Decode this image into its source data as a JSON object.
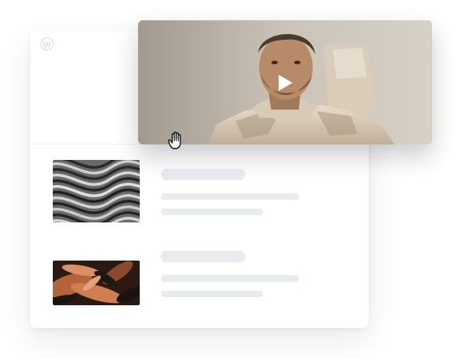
{
  "icons": {
    "logo": "wordpress-logo-icon",
    "play": "play-icon",
    "cursor": "grab-hand-cursor-icon"
  },
  "colors": {
    "page_background": "#ffffff",
    "card_background": "#ffffff",
    "skeleton": "#e8ecf1",
    "play_icon": "#ffffff"
  },
  "posts": [
    {
      "thumbnail": "abstract-wavy-stripes-image",
      "title": "",
      "line1": "",
      "line2": ""
    },
    {
      "thumbnail": "feathers-image",
      "title": "",
      "line1": "",
      "line2": ""
    }
  ],
  "video": {
    "poster": "astronaut-man-video-frame"
  }
}
